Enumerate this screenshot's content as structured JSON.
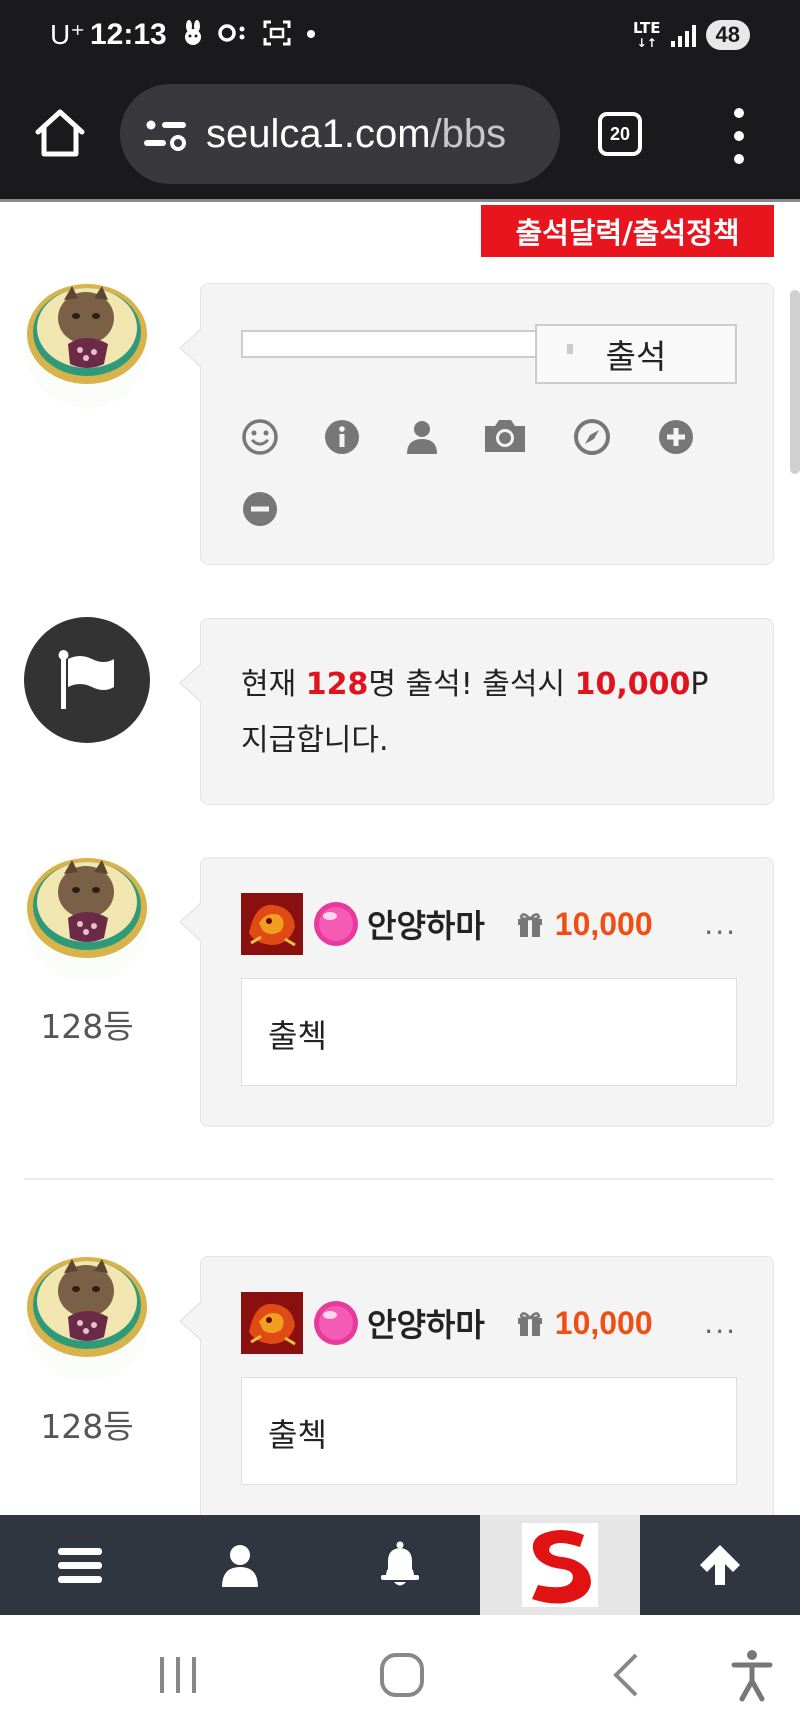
{
  "status_bar": {
    "carrier": "U⁺",
    "time": "12:13",
    "notification_icons": [
      "rabbit-icon",
      "key-icon",
      "face-icon",
      "dot-icon"
    ],
    "network": "LTE",
    "battery": "48"
  },
  "browser": {
    "url_host": "seulca1.com",
    "url_path": "/bbs",
    "tab_count": "20"
  },
  "attendance": {
    "policy_button": "출석달력/출석정책",
    "input_value": "",
    "submit_button": "출석",
    "toolbar_icons": [
      "smile-icon",
      "info-icon",
      "user-icon",
      "camera-icon",
      "compass-icon",
      "plus-circle-icon",
      "minus-circle-icon"
    ],
    "notice": {
      "prefix": "현재 ",
      "count": "128",
      "middle": "명 출석! 출석시 ",
      "reward": "10,000",
      "suffix_line1": "P",
      "line2": "지급합니다."
    }
  },
  "comments": [
    {
      "rank": "128등",
      "nickname": "안양하마",
      "points": "10,000",
      "more": "...",
      "text": "출첵"
    },
    {
      "rank": "128등",
      "nickname": "안양하마",
      "points": "10,000",
      "more": "...",
      "text": "출첵"
    }
  ],
  "bottom_nav": [
    "hamburger-menu-icon",
    "user-icon",
    "bell-icon",
    "site-logo",
    "arrow-up-icon"
  ],
  "system_nav": [
    "recent-apps-icon",
    "home-icon",
    "back-icon",
    "accessibility-icon"
  ],
  "colors": {
    "accent_red": "#e8141e",
    "points_orange": "#f04e12",
    "nav_bg": "#2f3640",
    "browser_bg": "#1a1a1d"
  }
}
